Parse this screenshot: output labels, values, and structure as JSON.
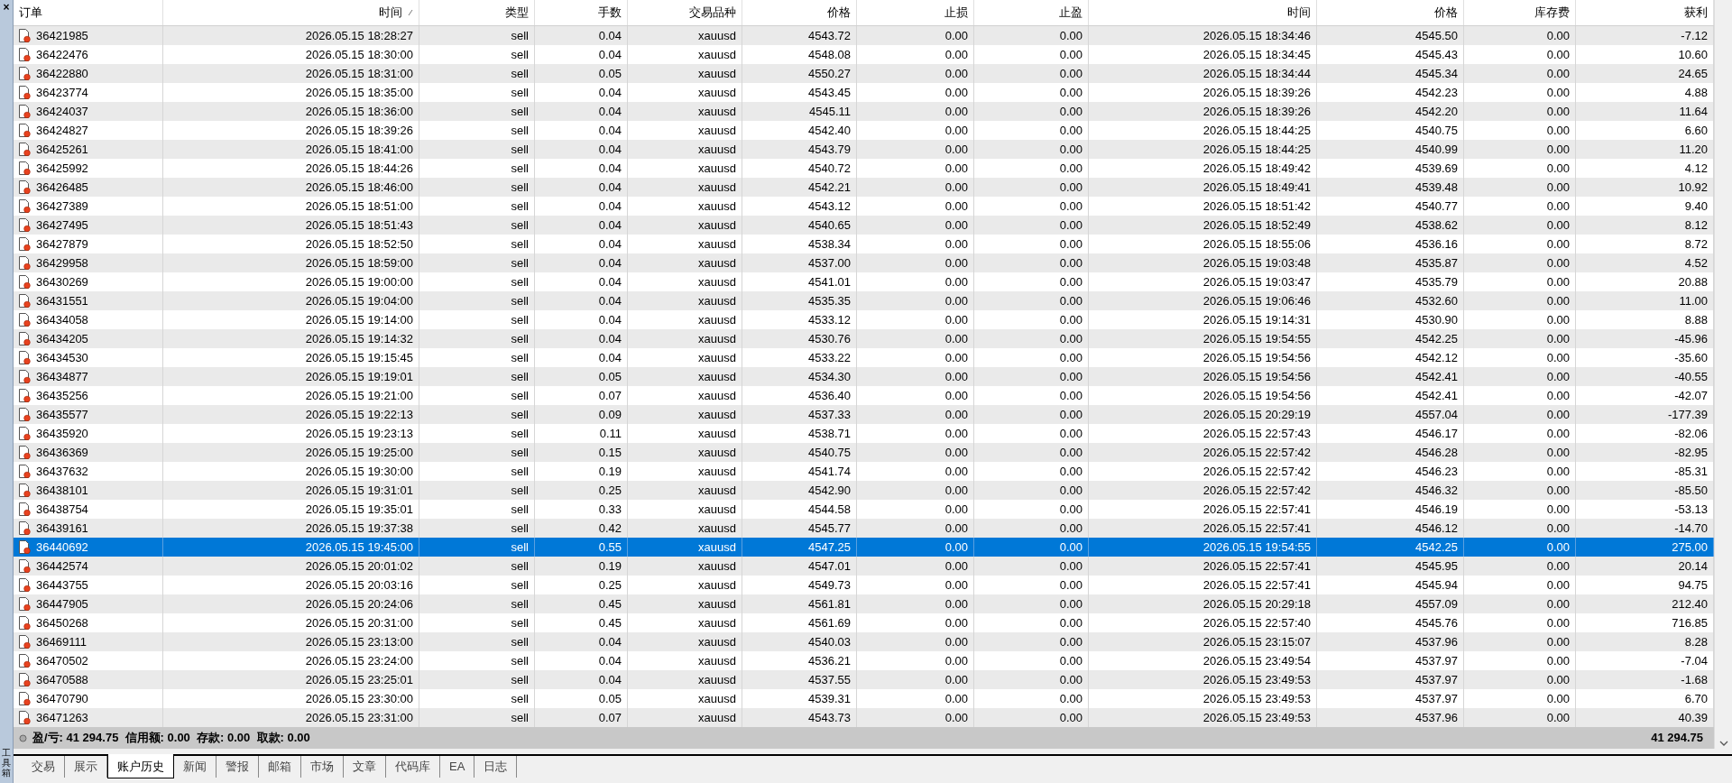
{
  "side_strip": {
    "close": "×",
    "label": "工具箱"
  },
  "table": {
    "columns": [
      {
        "label": "订单",
        "sorted": false
      },
      {
        "label": "时间",
        "sorted": true
      },
      {
        "label": "类型",
        "sorted": false
      },
      {
        "label": "手数",
        "sorted": false
      },
      {
        "label": "交易品种",
        "sorted": false
      },
      {
        "label": "价格",
        "sorted": false
      },
      {
        "label": "止损",
        "sorted": false
      },
      {
        "label": "止盈",
        "sorted": false
      },
      {
        "label": "时间",
        "sorted": false
      },
      {
        "label": "价格",
        "sorted": false
      },
      {
        "label": "库存费",
        "sorted": false
      },
      {
        "label": "获利",
        "sorted": false
      }
    ],
    "rows": [
      {
        "selected": false,
        "cells": [
          "36421985",
          "2026.05.15 18:28:27",
          "sell",
          "0.04",
          "xauusd",
          "4543.72",
          "0.00",
          "0.00",
          "2026.05.15 18:34:46",
          "4545.50",
          "0.00",
          "-7.12"
        ]
      },
      {
        "selected": false,
        "cells": [
          "36422476",
          "2026.05.15 18:30:00",
          "sell",
          "0.04",
          "xauusd",
          "4548.08",
          "0.00",
          "0.00",
          "2026.05.15 18:34:45",
          "4545.43",
          "0.00",
          "10.60"
        ]
      },
      {
        "selected": false,
        "cells": [
          "36422880",
          "2026.05.15 18:31:00",
          "sell",
          "0.05",
          "xauusd",
          "4550.27",
          "0.00",
          "0.00",
          "2026.05.15 18:34:44",
          "4545.34",
          "0.00",
          "24.65"
        ]
      },
      {
        "selected": false,
        "cells": [
          "36423774",
          "2026.05.15 18:35:00",
          "sell",
          "0.04",
          "xauusd",
          "4543.45",
          "0.00",
          "0.00",
          "2026.05.15 18:39:26",
          "4542.23",
          "0.00",
          "4.88"
        ]
      },
      {
        "selected": false,
        "cells": [
          "36424037",
          "2026.05.15 18:36:00",
          "sell",
          "0.04",
          "xauusd",
          "4545.11",
          "0.00",
          "0.00",
          "2026.05.15 18:39:26",
          "4542.20",
          "0.00",
          "11.64"
        ]
      },
      {
        "selected": false,
        "cells": [
          "36424827",
          "2026.05.15 18:39:26",
          "sell",
          "0.04",
          "xauusd",
          "4542.40",
          "0.00",
          "0.00",
          "2026.05.15 18:44:25",
          "4540.75",
          "0.00",
          "6.60"
        ]
      },
      {
        "selected": false,
        "cells": [
          "36425261",
          "2026.05.15 18:41:00",
          "sell",
          "0.04",
          "xauusd",
          "4543.79",
          "0.00",
          "0.00",
          "2026.05.15 18:44:25",
          "4540.99",
          "0.00",
          "11.20"
        ]
      },
      {
        "selected": false,
        "cells": [
          "36425992",
          "2026.05.15 18:44:26",
          "sell",
          "0.04",
          "xauusd",
          "4540.72",
          "0.00",
          "0.00",
          "2026.05.15 18:49:42",
          "4539.69",
          "0.00",
          "4.12"
        ]
      },
      {
        "selected": false,
        "cells": [
          "36426485",
          "2026.05.15 18:46:00",
          "sell",
          "0.04",
          "xauusd",
          "4542.21",
          "0.00",
          "0.00",
          "2026.05.15 18:49:41",
          "4539.48",
          "0.00",
          "10.92"
        ]
      },
      {
        "selected": false,
        "cells": [
          "36427389",
          "2026.05.15 18:51:00",
          "sell",
          "0.04",
          "xauusd",
          "4543.12",
          "0.00",
          "0.00",
          "2026.05.15 18:51:42",
          "4540.77",
          "0.00",
          "9.40"
        ]
      },
      {
        "selected": false,
        "cells": [
          "36427495",
          "2026.05.15 18:51:43",
          "sell",
          "0.04",
          "xauusd",
          "4540.65",
          "0.00",
          "0.00",
          "2026.05.15 18:52:49",
          "4538.62",
          "0.00",
          "8.12"
        ]
      },
      {
        "selected": false,
        "cells": [
          "36427879",
          "2026.05.15 18:52:50",
          "sell",
          "0.04",
          "xauusd",
          "4538.34",
          "0.00",
          "0.00",
          "2026.05.15 18:55:06",
          "4536.16",
          "0.00",
          "8.72"
        ]
      },
      {
        "selected": false,
        "cells": [
          "36429958",
          "2026.05.15 18:59:00",
          "sell",
          "0.04",
          "xauusd",
          "4537.00",
          "0.00",
          "0.00",
          "2026.05.15 19:03:48",
          "4535.87",
          "0.00",
          "4.52"
        ]
      },
      {
        "selected": false,
        "cells": [
          "36430269",
          "2026.05.15 19:00:00",
          "sell",
          "0.04",
          "xauusd",
          "4541.01",
          "0.00",
          "0.00",
          "2026.05.15 19:03:47",
          "4535.79",
          "0.00",
          "20.88"
        ]
      },
      {
        "selected": false,
        "cells": [
          "36431551",
          "2026.05.15 19:04:00",
          "sell",
          "0.04",
          "xauusd",
          "4535.35",
          "0.00",
          "0.00",
          "2026.05.15 19:06:46",
          "4532.60",
          "0.00",
          "11.00"
        ]
      },
      {
        "selected": false,
        "cells": [
          "36434058",
          "2026.05.15 19:14:00",
          "sell",
          "0.04",
          "xauusd",
          "4533.12",
          "0.00",
          "0.00",
          "2026.05.15 19:14:31",
          "4530.90",
          "0.00",
          "8.88"
        ]
      },
      {
        "selected": false,
        "cells": [
          "36434205",
          "2026.05.15 19:14:32",
          "sell",
          "0.04",
          "xauusd",
          "4530.76",
          "0.00",
          "0.00",
          "2026.05.15 19:54:55",
          "4542.25",
          "0.00",
          "-45.96"
        ]
      },
      {
        "selected": false,
        "cells": [
          "36434530",
          "2026.05.15 19:15:45",
          "sell",
          "0.04",
          "xauusd",
          "4533.22",
          "0.00",
          "0.00",
          "2026.05.15 19:54:56",
          "4542.12",
          "0.00",
          "-35.60"
        ]
      },
      {
        "selected": false,
        "cells": [
          "36434877",
          "2026.05.15 19:19:01",
          "sell",
          "0.05",
          "xauusd",
          "4534.30",
          "0.00",
          "0.00",
          "2026.05.15 19:54:56",
          "4542.41",
          "0.00",
          "-40.55"
        ]
      },
      {
        "selected": false,
        "cells": [
          "36435256",
          "2026.05.15 19:21:00",
          "sell",
          "0.07",
          "xauusd",
          "4536.40",
          "0.00",
          "0.00",
          "2026.05.15 19:54:56",
          "4542.41",
          "0.00",
          "-42.07"
        ]
      },
      {
        "selected": false,
        "cells": [
          "36435577",
          "2026.05.15 19:22:13",
          "sell",
          "0.09",
          "xauusd",
          "4537.33",
          "0.00",
          "0.00",
          "2026.05.15 20:29:19",
          "4557.04",
          "0.00",
          "-177.39"
        ]
      },
      {
        "selected": false,
        "cells": [
          "36435920",
          "2026.05.15 19:23:13",
          "sell",
          "0.11",
          "xauusd",
          "4538.71",
          "0.00",
          "0.00",
          "2026.05.15 22:57:43",
          "4546.17",
          "0.00",
          "-82.06"
        ]
      },
      {
        "selected": false,
        "cells": [
          "36436369",
          "2026.05.15 19:25:00",
          "sell",
          "0.15",
          "xauusd",
          "4540.75",
          "0.00",
          "0.00",
          "2026.05.15 22:57:42",
          "4546.28",
          "0.00",
          "-82.95"
        ]
      },
      {
        "selected": false,
        "cells": [
          "36437632",
          "2026.05.15 19:30:00",
          "sell",
          "0.19",
          "xauusd",
          "4541.74",
          "0.00",
          "0.00",
          "2026.05.15 22:57:42",
          "4546.23",
          "0.00",
          "-85.31"
        ]
      },
      {
        "selected": false,
        "cells": [
          "36438101",
          "2026.05.15 19:31:01",
          "sell",
          "0.25",
          "xauusd",
          "4542.90",
          "0.00",
          "0.00",
          "2026.05.15 22:57:42",
          "4546.32",
          "0.00",
          "-85.50"
        ]
      },
      {
        "selected": false,
        "cells": [
          "36438754",
          "2026.05.15 19:35:01",
          "sell",
          "0.33",
          "xauusd",
          "4544.58",
          "0.00",
          "0.00",
          "2026.05.15 22:57:41",
          "4546.19",
          "0.00",
          "-53.13"
        ]
      },
      {
        "selected": false,
        "cells": [
          "36439161",
          "2026.05.15 19:37:38",
          "sell",
          "0.42",
          "xauusd",
          "4545.77",
          "0.00",
          "0.00",
          "2026.05.15 22:57:41",
          "4546.12",
          "0.00",
          "-14.70"
        ]
      },
      {
        "selected": true,
        "cells": [
          "36440692",
          "2026.05.15 19:45:00",
          "sell",
          "0.55",
          "xauusd",
          "4547.25",
          "0.00",
          "0.00",
          "2026.05.15 19:54:55",
          "4542.25",
          "0.00",
          "275.00"
        ]
      },
      {
        "selected": false,
        "cells": [
          "36442574",
          "2026.05.15 20:01:02",
          "sell",
          "0.19",
          "xauusd",
          "4547.01",
          "0.00",
          "0.00",
          "2026.05.15 22:57:41",
          "4545.95",
          "0.00",
          "20.14"
        ]
      },
      {
        "selected": false,
        "cells": [
          "36443755",
          "2026.05.15 20:03:16",
          "sell",
          "0.25",
          "xauusd",
          "4549.73",
          "0.00",
          "0.00",
          "2026.05.15 22:57:41",
          "4545.94",
          "0.00",
          "94.75"
        ]
      },
      {
        "selected": false,
        "cells": [
          "36447905",
          "2026.05.15 20:24:06",
          "sell",
          "0.45",
          "xauusd",
          "4561.81",
          "0.00",
          "0.00",
          "2026.05.15 20:29:18",
          "4557.09",
          "0.00",
          "212.40"
        ]
      },
      {
        "selected": false,
        "cells": [
          "36450268",
          "2026.05.15 20:31:00",
          "sell",
          "0.45",
          "xauusd",
          "4561.69",
          "0.00",
          "0.00",
          "2026.05.15 22:57:40",
          "4545.76",
          "0.00",
          "716.85"
        ]
      },
      {
        "selected": false,
        "cells": [
          "36469111",
          "2026.05.15 23:13:00",
          "sell",
          "0.04",
          "xauusd",
          "4540.03",
          "0.00",
          "0.00",
          "2026.05.15 23:15:07",
          "4537.96",
          "0.00",
          "8.28"
        ]
      },
      {
        "selected": false,
        "cells": [
          "36470502",
          "2026.05.15 23:24:00",
          "sell",
          "0.04",
          "xauusd",
          "4536.21",
          "0.00",
          "0.00",
          "2026.05.15 23:49:54",
          "4537.97",
          "0.00",
          "-7.04"
        ]
      },
      {
        "selected": false,
        "cells": [
          "36470588",
          "2026.05.15 23:25:01",
          "sell",
          "0.04",
          "xauusd",
          "4537.55",
          "0.00",
          "0.00",
          "2026.05.15 23:49:53",
          "4537.97",
          "0.00",
          "-1.68"
        ]
      },
      {
        "selected": false,
        "cells": [
          "36470790",
          "2026.05.15 23:30:00",
          "sell",
          "0.05",
          "xauusd",
          "4539.31",
          "0.00",
          "0.00",
          "2026.05.15 23:49:53",
          "4537.97",
          "0.00",
          "6.70"
        ]
      },
      {
        "selected": false,
        "cells": [
          "36471263",
          "2026.05.15 23:31:00",
          "sell",
          "0.07",
          "xauusd",
          "4543.73",
          "0.00",
          "0.00",
          "2026.05.15 23:49:53",
          "4537.96",
          "0.00",
          "40.39"
        ]
      }
    ],
    "summary": {
      "text": "盈/亏: 41 294.75  信用额: 0.00  存款: 0.00  取款: 0.00",
      "total": "41 294.75"
    }
  },
  "tabs": [
    {
      "label": "交易",
      "selected": false
    },
    {
      "label": "展示",
      "selected": false
    },
    {
      "label": "账户历史",
      "selected": true
    },
    {
      "label": "新闻",
      "selected": false
    },
    {
      "label": "警报",
      "selected": false
    },
    {
      "label": "邮箱",
      "selected": false
    },
    {
      "label": "市场",
      "selected": false
    },
    {
      "label": "文章",
      "selected": false
    },
    {
      "label": "代码库",
      "selected": false
    },
    {
      "label": "EA",
      "selected": false
    },
    {
      "label": "日志",
      "selected": false
    }
  ]
}
